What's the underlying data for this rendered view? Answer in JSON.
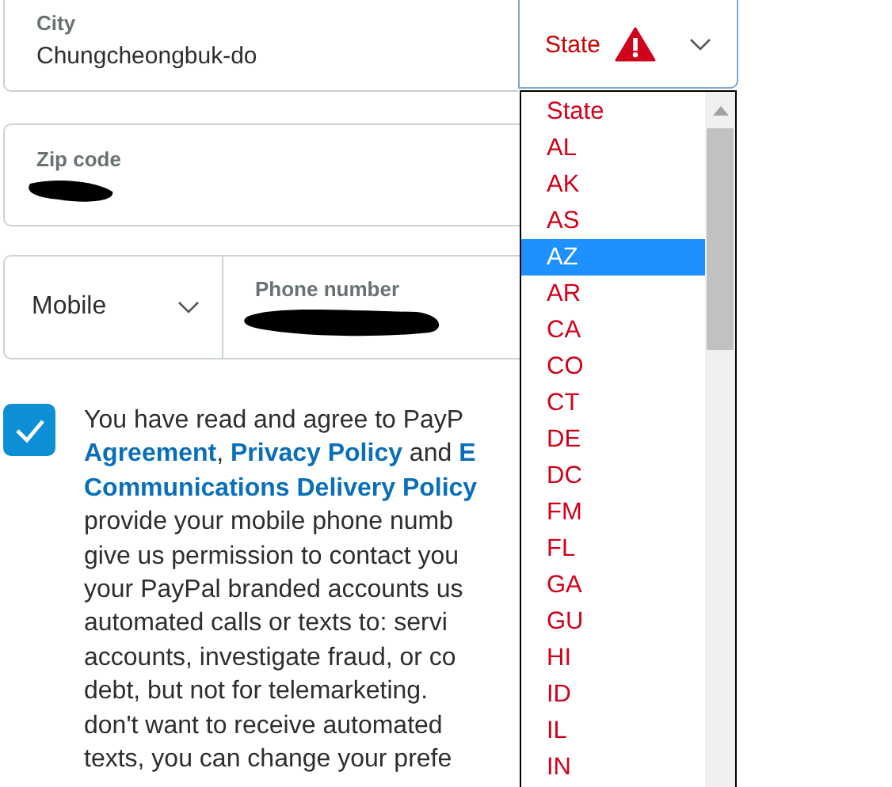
{
  "city_field": {
    "label": "City",
    "value": "Chungcheongbuk-do"
  },
  "state_select": {
    "value": "State",
    "error": true
  },
  "zip_field": {
    "label": "Zip code",
    "value_redacted": true
  },
  "phone_type_select": {
    "value": "Mobile"
  },
  "phone_field": {
    "label": "Phone number",
    "value_redacted": true
  },
  "consent": {
    "checked": true,
    "lines": [
      [
        {
          "text": "You have read and agree to PayP",
          "link": false
        }
      ],
      [
        {
          "text": "Agreement",
          "link": true
        },
        {
          "text": ", ",
          "link": false
        },
        {
          "text": "Privacy Policy",
          "link": true
        },
        {
          "text": " and ",
          "link": false
        },
        {
          "text": "E",
          "link": true
        }
      ],
      [
        {
          "text": "Communications Delivery Policy",
          "link": true
        }
      ],
      [
        {
          "text": "provide your mobile phone numb",
          "link": false
        }
      ],
      [
        {
          "text": "give us permission to contact you",
          "link": false
        }
      ],
      [
        {
          "text": "your PayPal branded accounts us",
          "link": false
        }
      ],
      [
        {
          "text": "automated calls or texts to: servi",
          "link": false
        }
      ],
      [
        {
          "text": "accounts, investigate fraud, or co",
          "link": false
        }
      ],
      [
        {
          "text": "debt, but not for telemarketing.",
          "link": false
        }
      ],
      [
        {
          "text": "don't want to receive automated",
          "link": false
        }
      ],
      [
        {
          "text": "texts, you can change your prefe",
          "link": false
        }
      ]
    ]
  },
  "state_options": [
    {
      "label": "State",
      "selected": false
    },
    {
      "label": "AL",
      "selected": false
    },
    {
      "label": "AK",
      "selected": false
    },
    {
      "label": "AS",
      "selected": false
    },
    {
      "label": "AZ",
      "selected": true
    },
    {
      "label": "AR",
      "selected": false
    },
    {
      "label": "CA",
      "selected": false
    },
    {
      "label": "CO",
      "selected": false
    },
    {
      "label": "CT",
      "selected": false
    },
    {
      "label": "DE",
      "selected": false
    },
    {
      "label": "DC",
      "selected": false
    },
    {
      "label": "FM",
      "selected": false
    },
    {
      "label": "FL",
      "selected": false
    },
    {
      "label": "GA",
      "selected": false
    },
    {
      "label": "GU",
      "selected": false
    },
    {
      "label": "HI",
      "selected": false
    },
    {
      "label": "ID",
      "selected": false
    },
    {
      "label": "IL",
      "selected": false
    },
    {
      "label": "IN",
      "selected": false
    }
  ]
}
